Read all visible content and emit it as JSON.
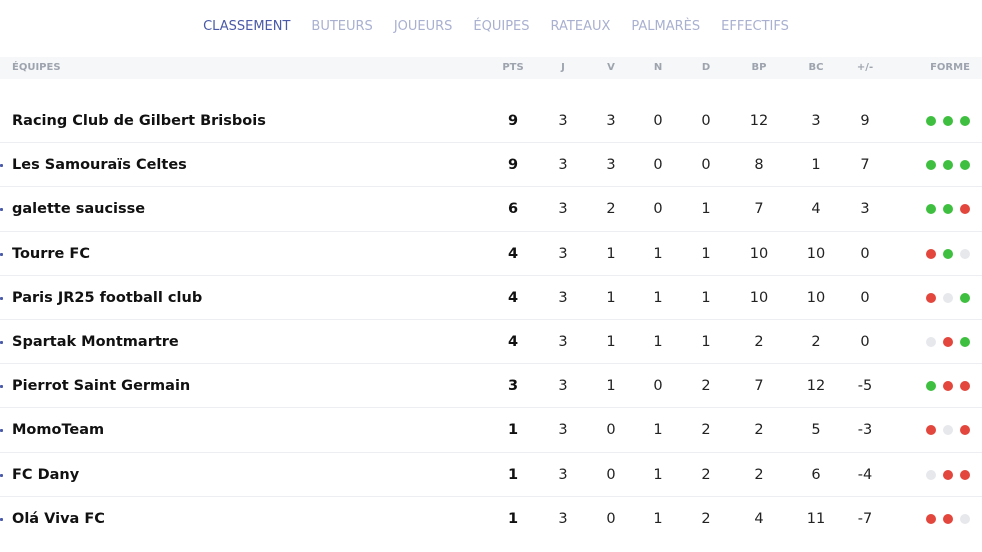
{
  "nav": {
    "tabs": [
      {
        "label": "CLASSEMENT",
        "active": true
      },
      {
        "label": "BUTEURS",
        "active": false
      },
      {
        "label": "JOUEURS",
        "active": false
      },
      {
        "label": "ÉQUIPES",
        "active": false
      },
      {
        "label": "RATEAUX",
        "active": false
      },
      {
        "label": "PALMARÈS",
        "active": false
      },
      {
        "label": "EFFECTIFS",
        "active": false
      }
    ]
  },
  "table": {
    "headers": {
      "team": "ÉQUIPES",
      "pts": "PTS",
      "j": "J",
      "v": "V",
      "n": "N",
      "d": "D",
      "bp": "BP",
      "bc": "BC",
      "diff": "+/-",
      "form": "FORME"
    },
    "rows": [
      {
        "team": "Racing Club de Gilbert Brisbois",
        "pts": "9",
        "j": "3",
        "v": "3",
        "n": "0",
        "d": "0",
        "bp": "12",
        "bc": "3",
        "diff": "9",
        "form": [
          "win",
          "win",
          "win"
        ]
      },
      {
        "team": "Les Samouraïs Celtes",
        "pts": "9",
        "j": "3",
        "v": "3",
        "n": "0",
        "d": "0",
        "bp": "8",
        "bc": "1",
        "diff": "7",
        "form": [
          "win",
          "win",
          "win"
        ]
      },
      {
        "team": "galette saucisse",
        "pts": "6",
        "j": "3",
        "v": "2",
        "n": "0",
        "d": "1",
        "bp": "7",
        "bc": "4",
        "diff": "3",
        "form": [
          "win",
          "win",
          "loss"
        ]
      },
      {
        "team": "Tourre FC",
        "pts": "4",
        "j": "3",
        "v": "1",
        "n": "1",
        "d": "1",
        "bp": "10",
        "bc": "10",
        "diff": "0",
        "form": [
          "loss",
          "win",
          "draw"
        ]
      },
      {
        "team": "Paris JR25 football club",
        "pts": "4",
        "j": "3",
        "v": "1",
        "n": "1",
        "d": "1",
        "bp": "10",
        "bc": "10",
        "diff": "0",
        "form": [
          "loss",
          "draw",
          "win"
        ]
      },
      {
        "team": "Spartak Montmartre",
        "pts": "4",
        "j": "3",
        "v": "1",
        "n": "1",
        "d": "1",
        "bp": "2",
        "bc": "2",
        "diff": "0",
        "form": [
          "draw",
          "loss",
          "win"
        ]
      },
      {
        "team": "Pierrot Saint Germain",
        "pts": "3",
        "j": "3",
        "v": "1",
        "n": "0",
        "d": "2",
        "bp": "7",
        "bc": "12",
        "diff": "-5",
        "form": [
          "win",
          "loss",
          "loss"
        ]
      },
      {
        "team": "MomoTeam",
        "pts": "1",
        "j": "3",
        "v": "0",
        "n": "1",
        "d": "2",
        "bp": "2",
        "bc": "5",
        "diff": "-3",
        "form": [
          "loss",
          "draw",
          "loss"
        ]
      },
      {
        "team": "FC Dany",
        "pts": "1",
        "j": "3",
        "v": "0",
        "n": "1",
        "d": "2",
        "bp": "2",
        "bc": "6",
        "diff": "-4",
        "form": [
          "draw",
          "loss",
          "loss"
        ]
      },
      {
        "team": "Olá Viva FC",
        "pts": "1",
        "j": "3",
        "v": "0",
        "n": "1",
        "d": "2",
        "bp": "4",
        "bc": "11",
        "diff": "-7",
        "form": [
          "loss",
          "loss",
          "draw"
        ]
      }
    ]
  },
  "colors": {
    "win": "#3fbf3f",
    "loss": "#e2463c",
    "draw": "#e6e8ec",
    "tab_active": "#4a5aa8",
    "tab_inactive": "#a9b0d0"
  }
}
